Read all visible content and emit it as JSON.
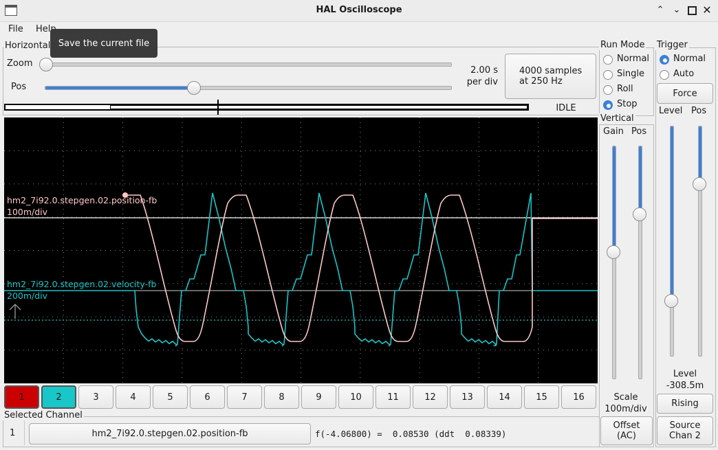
{
  "window": {
    "title": "HAL Oscilloscope"
  },
  "menu": {
    "file": "File",
    "help": "Help"
  },
  "tooltip": "Save the current file",
  "horizontal": {
    "label": "Horizontal",
    "zoom_label": "Zoom",
    "pos_label": "Pos",
    "zoom_value": 0.0,
    "pos_value": 0.37,
    "time_per_div": "2.00 s",
    "per_div": "per div",
    "samples_line1": "4000 samples",
    "samples_line2": "at 250 Hz",
    "status": "IDLE"
  },
  "run_mode": {
    "label": "Run Mode",
    "options": [
      "Normal",
      "Single",
      "Roll",
      "Stop"
    ],
    "selected": "Stop"
  },
  "trigger": {
    "label": "Trigger",
    "options": [
      "Normal",
      "Auto"
    ],
    "selected": "Normal",
    "force_label": "Force",
    "level_label": "Level",
    "pos_label": "Pos",
    "level_value_label": "Level",
    "level_value": "-308.5m",
    "rising_label": "Rising",
    "source_line1": "Source",
    "source_line2": "Chan  2"
  },
  "vertical": {
    "label": "Vertical",
    "gain_label": "Gain",
    "pos_label": "Pos",
    "scale_label": "Scale",
    "scale_value": "100m/div",
    "offset_line1": "Offset",
    "offset_line2": "(AC)"
  },
  "traces": [
    {
      "name": "hm2_7i92.0.stepgen.02.position-fb",
      "scale": "100m/div",
      "color": "#ffc8c8"
    },
    {
      "name": "hm2_7i92.0.stepgen.02.velocity-fb",
      "scale": "200m/div",
      "color": "#19c6c8"
    }
  ],
  "channels": [
    "1",
    "2",
    "3",
    "4",
    "5",
    "6",
    "7",
    "8",
    "9",
    "10",
    "11",
    "12",
    "13",
    "14",
    "15",
    "16"
  ],
  "channel_colors": {
    "1": "#cc0000",
    "2": "#19c6c8"
  },
  "selected_channel": {
    "label": "Selected Channel",
    "number": "1",
    "name": "hm2_7i92.0.stepgen.02.position-fb",
    "readout": "f(-4.06800) =  0.08530 (ddt  0.08339)"
  }
}
